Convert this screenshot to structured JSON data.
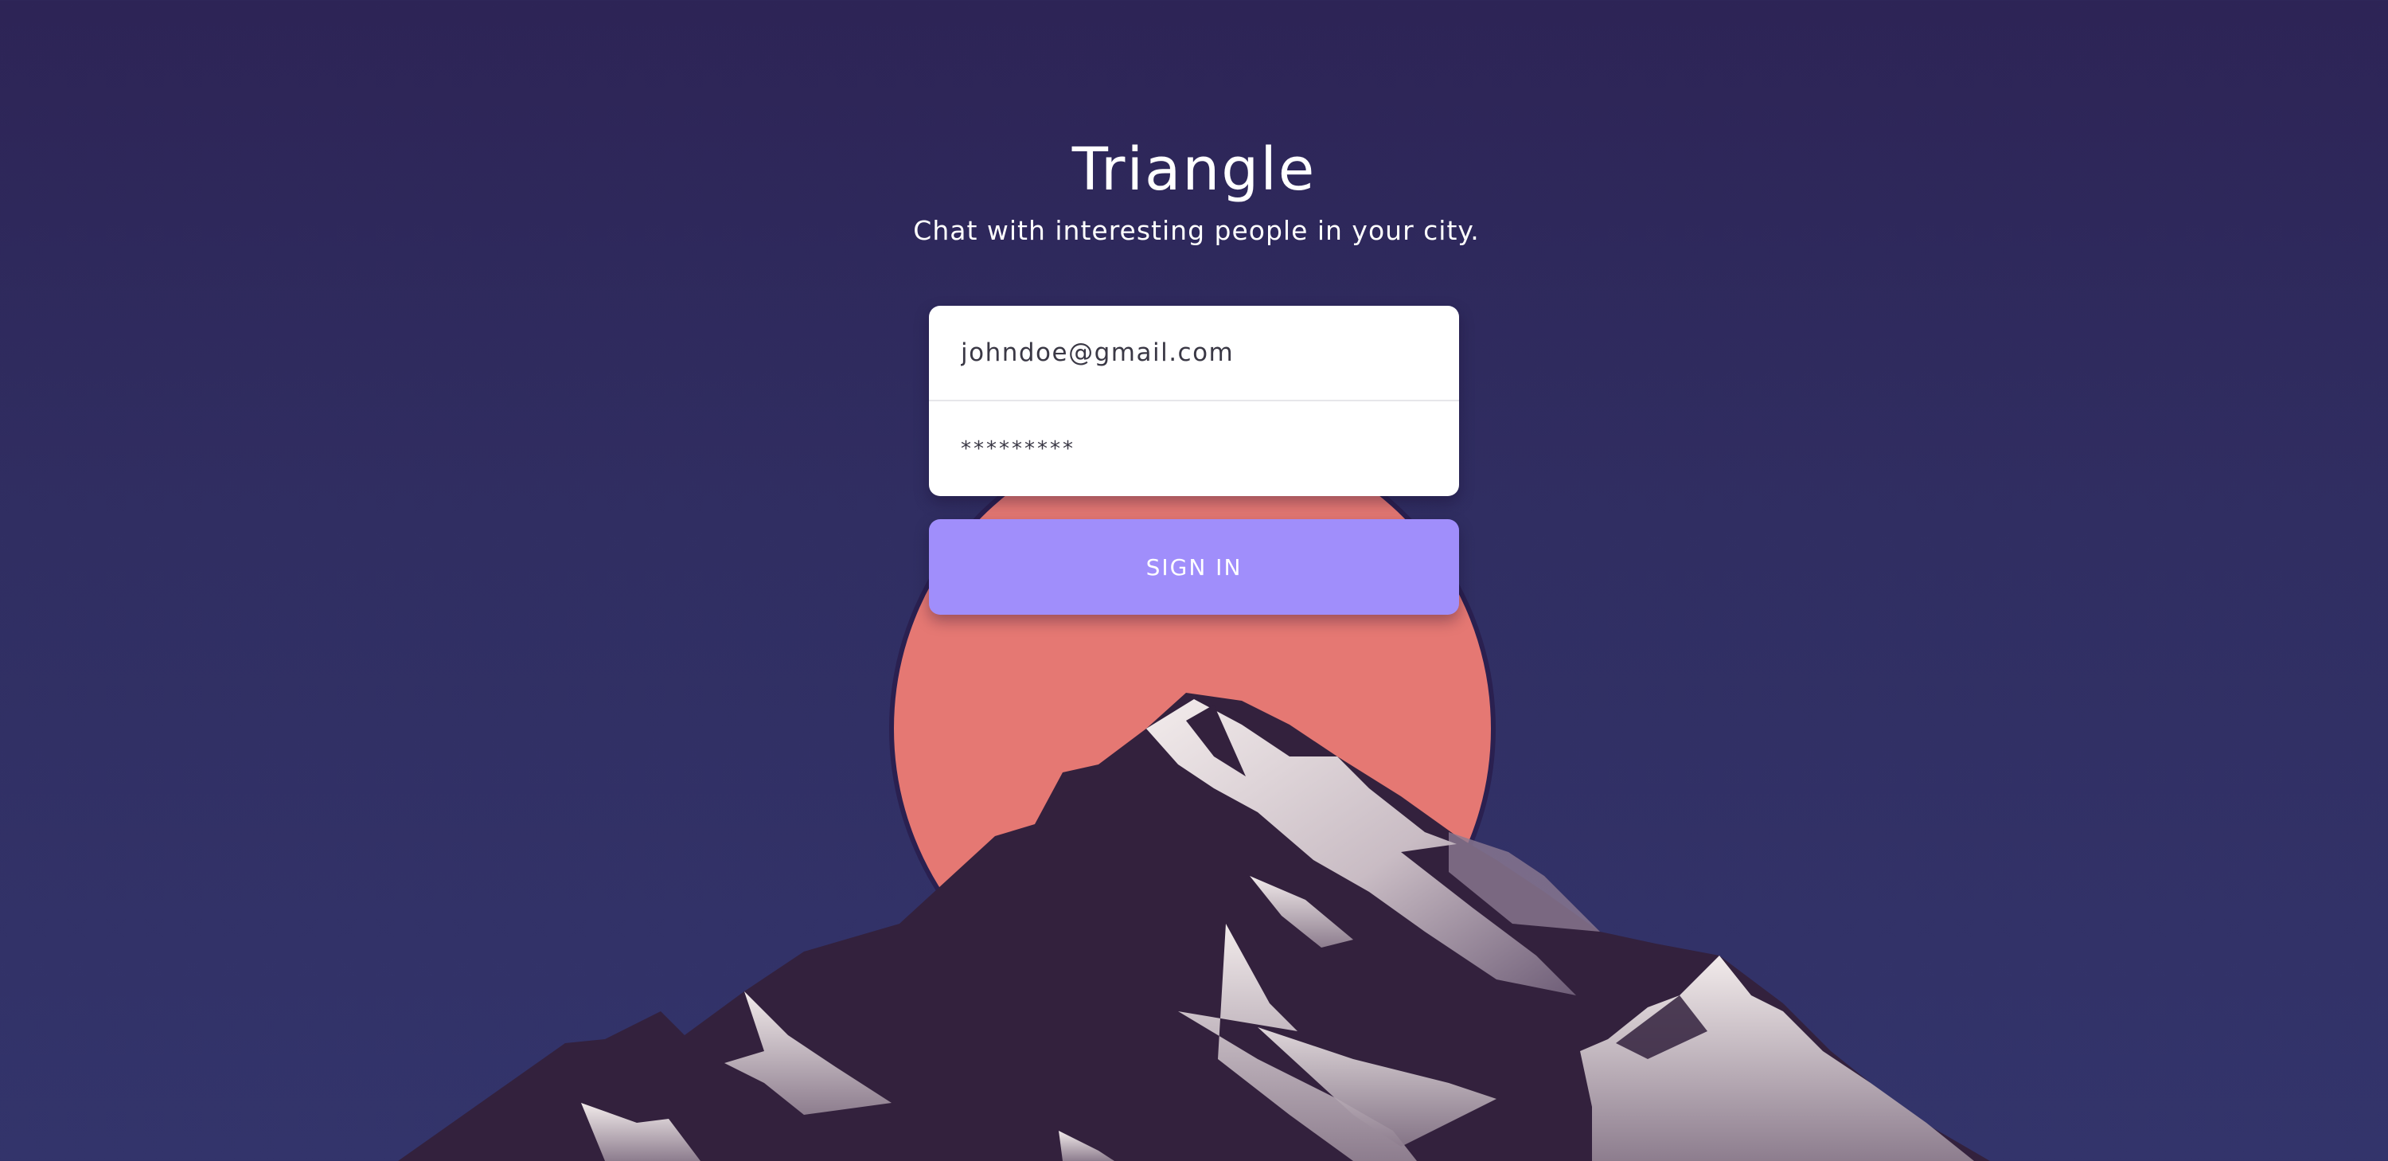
{
  "app": {
    "title": "Triangle",
    "tagline": "Chat with interesting people in your city."
  },
  "login": {
    "email_value": "johndoe@gmail.com",
    "password_value": "*********",
    "signin_label": "SIGN IN"
  },
  "colors": {
    "background": "#2f2b5f",
    "sun": "#e57873",
    "button": "#a08efb",
    "mountain_dark": "#33213d",
    "snow": "#e8e0e2"
  }
}
